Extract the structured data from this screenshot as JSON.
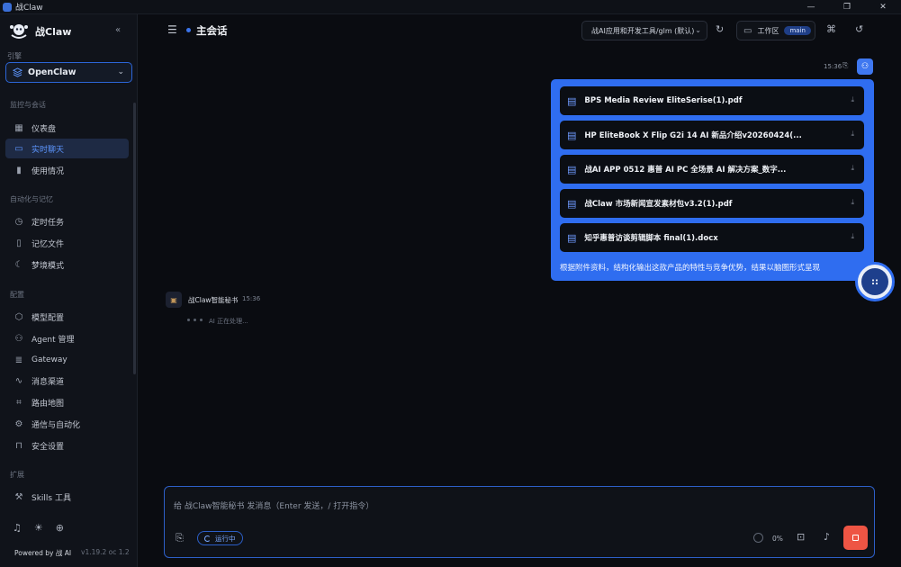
{
  "window": {
    "title": "战Claw",
    "controls": [
      "—",
      "❐",
      "✕"
    ]
  },
  "sidebar": {
    "brand_name": "战Claw",
    "collapse_glyph": "«",
    "engine_label": "引擎",
    "engine_value": "OpenClaw",
    "sections": [
      {
        "label": "监控与会话",
        "items": [
          {
            "label": "仪表盘",
            "icon": "dashboard-icon",
            "glyph": "▦"
          },
          {
            "label": "实时聊天",
            "icon": "chat-icon",
            "glyph": "▭"
          },
          {
            "label": "使用情况",
            "icon": "bar-chart-icon",
            "glyph": "▮"
          }
        ]
      },
      {
        "label": "自动化与记忆",
        "items": [
          {
            "label": "定时任务",
            "icon": "clock-icon",
            "glyph": "◷"
          },
          {
            "label": "记忆文件",
            "icon": "book-icon",
            "glyph": "▯"
          },
          {
            "label": "梦境模式",
            "icon": "moon-icon",
            "glyph": "☾"
          }
        ]
      },
      {
        "label": "配置",
        "items": [
          {
            "label": "模型配置",
            "icon": "cube-icon",
            "glyph": "⬡"
          },
          {
            "label": "Agent 管理",
            "icon": "users-icon",
            "glyph": "⚇"
          },
          {
            "label": "Gateway",
            "icon": "server-icon",
            "glyph": "≣"
          },
          {
            "label": "消息渠道",
            "icon": "activity-icon",
            "glyph": "∿"
          },
          {
            "label": "路由地图",
            "icon": "route-icon",
            "glyph": "⌗"
          },
          {
            "label": "通信与自动化",
            "icon": "gear-icon",
            "glyph": "⚙"
          },
          {
            "label": "安全设置",
            "icon": "lock-icon",
            "glyph": "⊓"
          }
        ]
      },
      {
        "label": "扩展",
        "items": [
          {
            "label": "Skills 工具",
            "icon": "wrench-icon",
            "glyph": "⚒"
          }
        ]
      }
    ],
    "active_item": "实时聊天",
    "footer": {
      "powered_by": "Powered by 战 AI",
      "version": "v1.19.2 oc 1.2",
      "icons": [
        {
          "name": "bell-icon",
          "glyph": "♫"
        },
        {
          "name": "sun-icon",
          "glyph": "☀"
        },
        {
          "name": "globe-icon",
          "glyph": "⊕"
        }
      ]
    }
  },
  "header": {
    "title": "主会话",
    "model_select": "战AI应用和开发工具/glm (默认)",
    "workspace_label": "工作区",
    "workspace_badge": "main"
  },
  "chat": {
    "user_message": {
      "time": "15:36",
      "files": [
        "BPS Media Review EliteSerise(1).pdf",
        "HP EliteBook X Flip G2i 14 AI 新品介绍v20260424(...",
        "战AI APP 0512 惠普 AI PC 全场景 AI 解决方案_数字...",
        "战Claw 市场新闻宣发素材包v3.2(1).pdf",
        "知乎惠普访谈剪辑脚本 final(1).docx"
      ],
      "text": "根据附件资料，结构化输出这款产品的特性与竞争优势，结果以脑图形式呈现"
    },
    "bot_message": {
      "name": "战Claw智能秘书",
      "time": "15:36",
      "status": "AI 正在处理..."
    }
  },
  "composer": {
    "placeholder": "给 战Claw智能秘书 发消息（Enter 发送，/ 打开指令）",
    "value": "",
    "run_status": "运行中",
    "context_usage": "0%"
  },
  "colors": {
    "accent": "#2f6df0",
    "stop": "#ee5544",
    "background": "#0a0c11",
    "sidebar": "#10131a"
  }
}
